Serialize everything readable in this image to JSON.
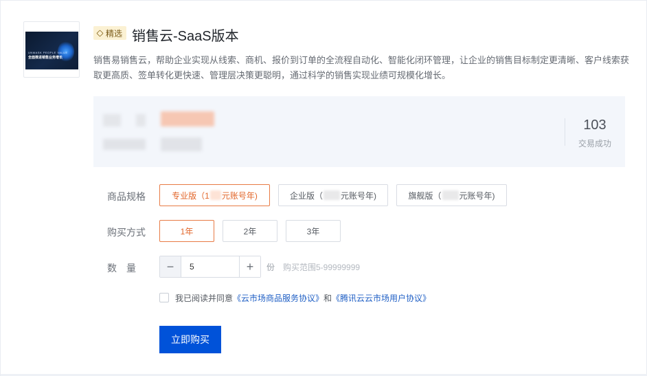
{
  "product": {
    "tag_label": "精选",
    "title": "销售云-SaaS版本",
    "description": "销售易销售云，帮助企业实现从线索、商机、报价到订单的全流程自动化、智能化闭环管理，让企业的销售目标制定更清晰、客户线索获取更高质、签单转化更快速、管理层决策更聪明，通过科学的销售实现业绩可规模化增长。",
    "thumbnail": {
      "line1": "UNMASK PEOPLE VALUE",
      "line2": "全面推进销售业务增长"
    }
  },
  "stats": {
    "deals_value": "103",
    "deals_label": "交易成功"
  },
  "spec": {
    "label": "商品规格",
    "options": [
      {
        "prefix": "专业版（1",
        "suffix": "元账号年)",
        "selected": true
      },
      {
        "prefix": "企业版（",
        "suffix": "元账号年)",
        "selected": false
      },
      {
        "prefix": "旗舰版（",
        "suffix": "元账号年)",
        "selected": false
      }
    ]
  },
  "purchase": {
    "label": "购买方式",
    "options": [
      {
        "label": "1年",
        "selected": true
      },
      {
        "label": "2年",
        "selected": false
      },
      {
        "label": "3年",
        "selected": false
      }
    ]
  },
  "quantity": {
    "label": "数　量",
    "value": "5",
    "minus": "−",
    "plus": "+",
    "unit": "份",
    "range": "购买范围5-99999999"
  },
  "agreement": {
    "prefix": "我已阅读并同意",
    "link1": "《云市场商品服务协议》",
    "and": "和",
    "link2": "《腾讯云云市场用户协议》"
  },
  "buy_button": "立即购买",
  "colors": {
    "accent": "#e2662a",
    "primary": "#0052d9",
    "tag_bg": "#fbf1d3"
  }
}
